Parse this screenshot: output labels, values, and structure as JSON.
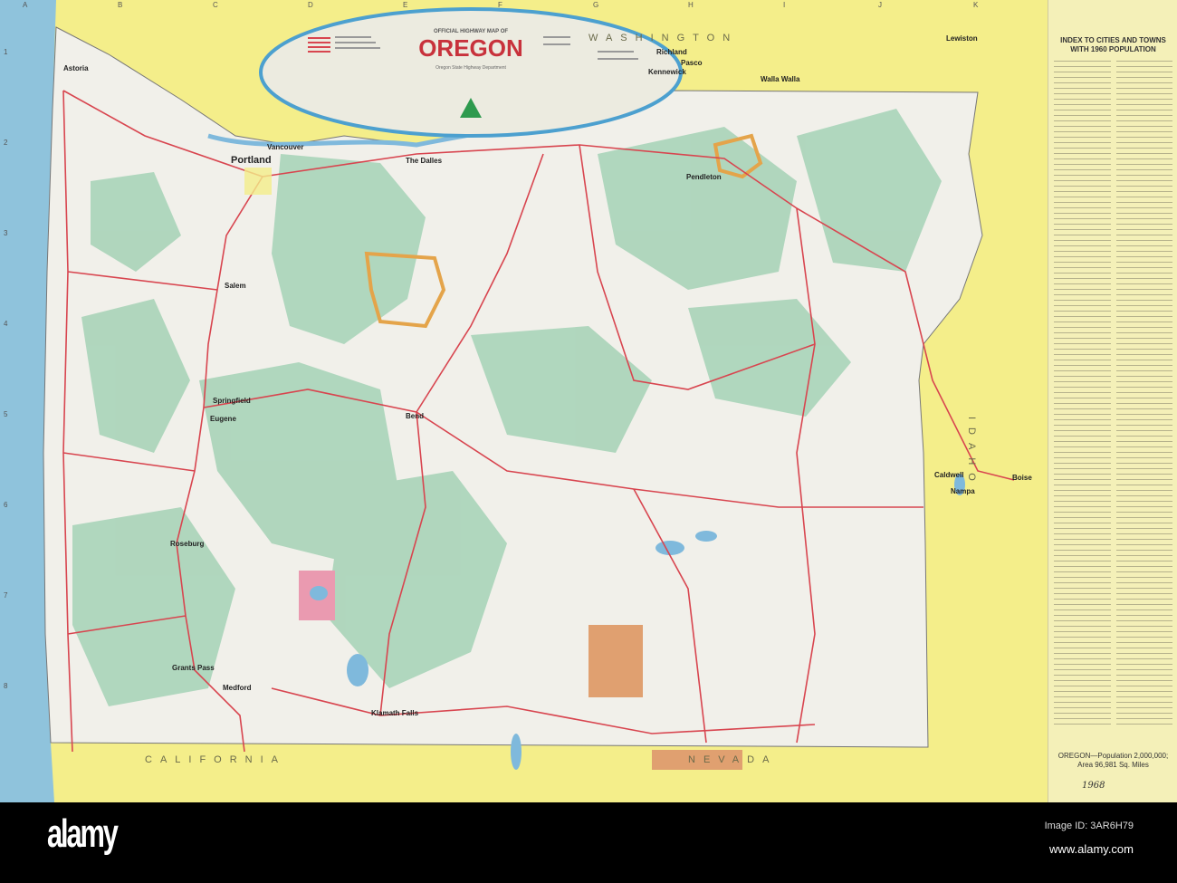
{
  "map": {
    "title_small": "OFFICIAL HIGHWAY MAP OF",
    "title": "OREGON",
    "legend_publisher": "Oregon State Highway Department",
    "year_note": "1968",
    "grid_letters": [
      "A",
      "B",
      "C",
      "D",
      "E",
      "F",
      "G",
      "H",
      "I",
      "J",
      "K"
    ],
    "grid_numbers": [
      "1",
      "2",
      "3",
      "4",
      "5",
      "6",
      "7",
      "8"
    ],
    "states": {
      "washington": "WASHINGTON",
      "idaho": "IDAHO",
      "nevada": "NEVADA",
      "california": "CALIFORNIA"
    },
    "cities": {
      "astoria": "Astoria",
      "portland": "Portland",
      "vancouver": "Vancouver",
      "the_dalles": "The Dalles",
      "salem": "Salem",
      "eugene": "Eugene",
      "springfield": "Springfield",
      "roseburg": "Roseburg",
      "grants_pass": "Grants Pass",
      "medford": "Medford",
      "klamath_falls": "Klamath Falls",
      "bend": "Bend",
      "pendleton": "Pendleton",
      "walla_walla": "Walla Walla",
      "kennewick": "Kennewick",
      "richland": "Richland",
      "pasco": "Pasco",
      "lewiston": "Lewiston",
      "caldwell": "Caldwell",
      "nampa": "Nampa",
      "boise": "Boise"
    },
    "colors": {
      "ocean": "#8fc3dc",
      "land_out": "#f4ee8a",
      "oregon": "#f1f0ea",
      "forest": "#a9d4b9",
      "road": "#d8454f",
      "title": "#c8323c",
      "ellipse": "#4ca0cf"
    }
  },
  "index": {
    "title": "INDEX TO CITIES AND TOWNS WITH 1960 POPULATION",
    "footer": "OREGON—Population 2,000,000; Area 96,981 Sq. Miles"
  },
  "banner": {
    "logo": "alamy",
    "image_id": "Image ID: 3AR6H79",
    "site": "www.alamy.com"
  }
}
